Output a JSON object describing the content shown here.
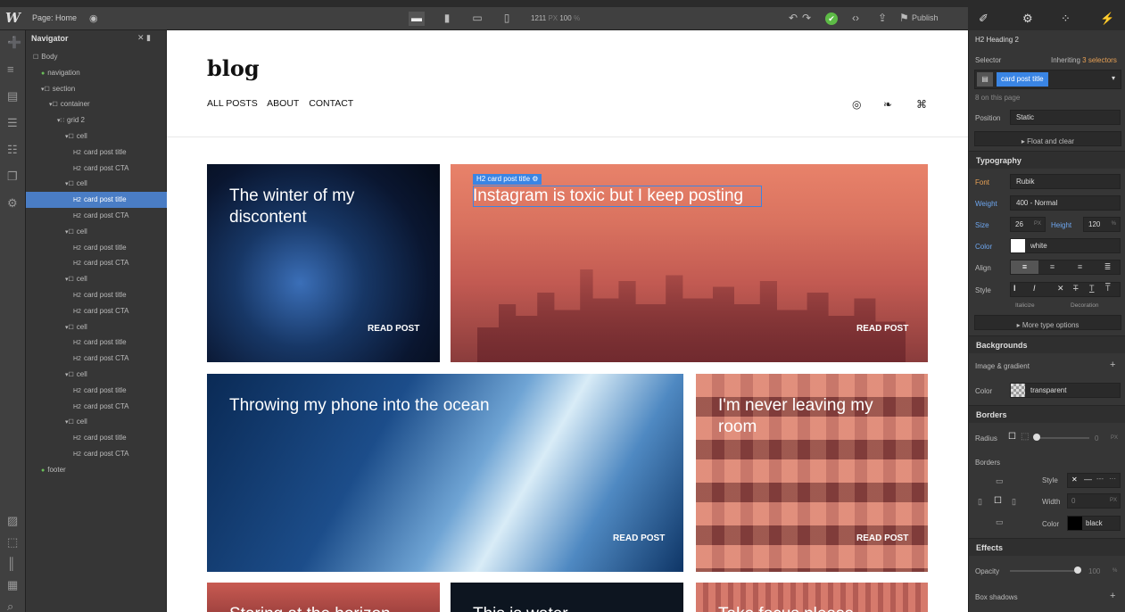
{
  "topbar": {
    "logo": "W",
    "page_label": "Page: Home",
    "eye_icon": "◉",
    "width_value": "1211",
    "width_unit": "PX",
    "zoom_value": "100",
    "zoom_unit": "%",
    "publish_label": "Publish",
    "devices": [
      "▬",
      "▮",
      "▭",
      "▯"
    ],
    "undo_icon": "↶",
    "redo_icon": "↷",
    "check_icon": "✔",
    "code_icon": "‹›",
    "export_icon": "⇪",
    "publish_icon": "⚑"
  },
  "right_tabs": [
    "✐",
    "⚙",
    "⁘",
    "⚡"
  ],
  "iconbar": [
    "➕",
    "≡",
    "▤",
    "☰",
    "☷",
    "❐",
    "⚙",
    "▨",
    "⬚",
    "║",
    "▦",
    "⌕"
  ],
  "navigator": {
    "title": "Navigator",
    "header_icons": "✕ ▮",
    "tree": [
      {
        "label": "Body",
        "indent": 0,
        "kind": "box"
      },
      {
        "label": "navigation",
        "indent": 1,
        "kind": "sym"
      },
      {
        "label": "section",
        "indent": 1,
        "kind": "box"
      },
      {
        "label": "container",
        "indent": 2,
        "kind": "box"
      },
      {
        "label": "grid 2",
        "indent": 3,
        "kind": "grid"
      },
      {
        "label": "cell",
        "indent": 4,
        "kind": "box"
      },
      {
        "label": "card post title",
        "indent": 5,
        "kind": "h2"
      },
      {
        "label": "card post CTA",
        "indent": 5,
        "kind": "h2"
      },
      {
        "label": "cell",
        "indent": 4,
        "kind": "box"
      },
      {
        "label": "card post title",
        "indent": 5,
        "kind": "h2",
        "selected": true
      },
      {
        "label": "card post CTA",
        "indent": 5,
        "kind": "h2"
      },
      {
        "label": "cell",
        "indent": 4,
        "kind": "box"
      },
      {
        "label": "card post title",
        "indent": 5,
        "kind": "h2"
      },
      {
        "label": "card post CTA",
        "indent": 5,
        "kind": "h2"
      },
      {
        "label": "cell",
        "indent": 4,
        "kind": "box"
      },
      {
        "label": "card post title",
        "indent": 5,
        "kind": "h2"
      },
      {
        "label": "card post CTA",
        "indent": 5,
        "kind": "h2"
      },
      {
        "label": "cell",
        "indent": 4,
        "kind": "box"
      },
      {
        "label": "card post title",
        "indent": 5,
        "kind": "h2"
      },
      {
        "label": "card post CTA",
        "indent": 5,
        "kind": "h2"
      },
      {
        "label": "cell",
        "indent": 4,
        "kind": "box"
      },
      {
        "label": "card post title",
        "indent": 5,
        "kind": "h2"
      },
      {
        "label": "card post CTA",
        "indent": 5,
        "kind": "h2"
      },
      {
        "label": "cell",
        "indent": 4,
        "kind": "box"
      },
      {
        "label": "card post title",
        "indent": 5,
        "kind": "h2"
      },
      {
        "label": "card post CTA",
        "indent": 5,
        "kind": "h2"
      },
      {
        "label": "footer",
        "indent": 1,
        "kind": "sym"
      }
    ]
  },
  "canvas": {
    "site_logo": "blog",
    "menu": [
      "ALL POSTS",
      "ABOUT",
      "CONTACT"
    ],
    "social_icons": [
      "◎",
      "❧",
      "⌘"
    ],
    "selection_chip": "H2 card post title ⚙",
    "cards": [
      {
        "title": "The winter of my discontent",
        "cta": "READ POST"
      },
      {
        "title": "Instagram is toxic but I keep posting",
        "cta": "READ POST"
      },
      {
        "title": "Throwing my phone into the ocean",
        "cta": "READ POST"
      },
      {
        "title": "I'm never leaving my room",
        "cta": "READ POST"
      },
      {
        "title": "Staring at the horizon",
        "cta": ""
      },
      {
        "title": "This is water",
        "cta": ""
      },
      {
        "title": "Take focus please",
        "cta": ""
      }
    ]
  },
  "panel": {
    "element": "H2 Heading 2",
    "selector_label": "Selector",
    "inheriting": "Inheriting",
    "inheriting_count": "3 selectors",
    "selector_chip": "card post title",
    "on_page": "8 on this page",
    "position_label": "Position",
    "position_value": "Static",
    "float_clear": "▸ Float and clear",
    "typography": "Typography",
    "font_label": "Font",
    "font_value": "Rubik",
    "weight_label": "Weight",
    "weight_value": "400 - Normal",
    "size_label": "Size",
    "size_value": "26",
    "size_unit": "PX",
    "height_label": "Height",
    "height_value": "120",
    "height_unit": "%",
    "color_label": "Color",
    "color_value": "white",
    "align_label": "Align",
    "style_label": "Style",
    "italicize": "Italicize",
    "decoration": "Decoration",
    "more_type": "▸ More type options",
    "backgrounds": "Backgrounds",
    "image_gradient": "Image & gradient",
    "bg_color_label": "Color",
    "bg_color_value": "transparent",
    "borders": "Borders",
    "radius_label": "Radius",
    "radius_value": "0",
    "radius_unit": "PX",
    "borders_label": "Borders",
    "style2_label": "Style",
    "width_label": "Width",
    "width_value": "0",
    "width_unit": "PX",
    "border_color_label": "Color",
    "border_color_value": "black",
    "effects": "Effects",
    "opacity_label": "Opacity",
    "opacity_value": "100",
    "opacity_unit": "%",
    "box_shadows": "Box shadows"
  }
}
